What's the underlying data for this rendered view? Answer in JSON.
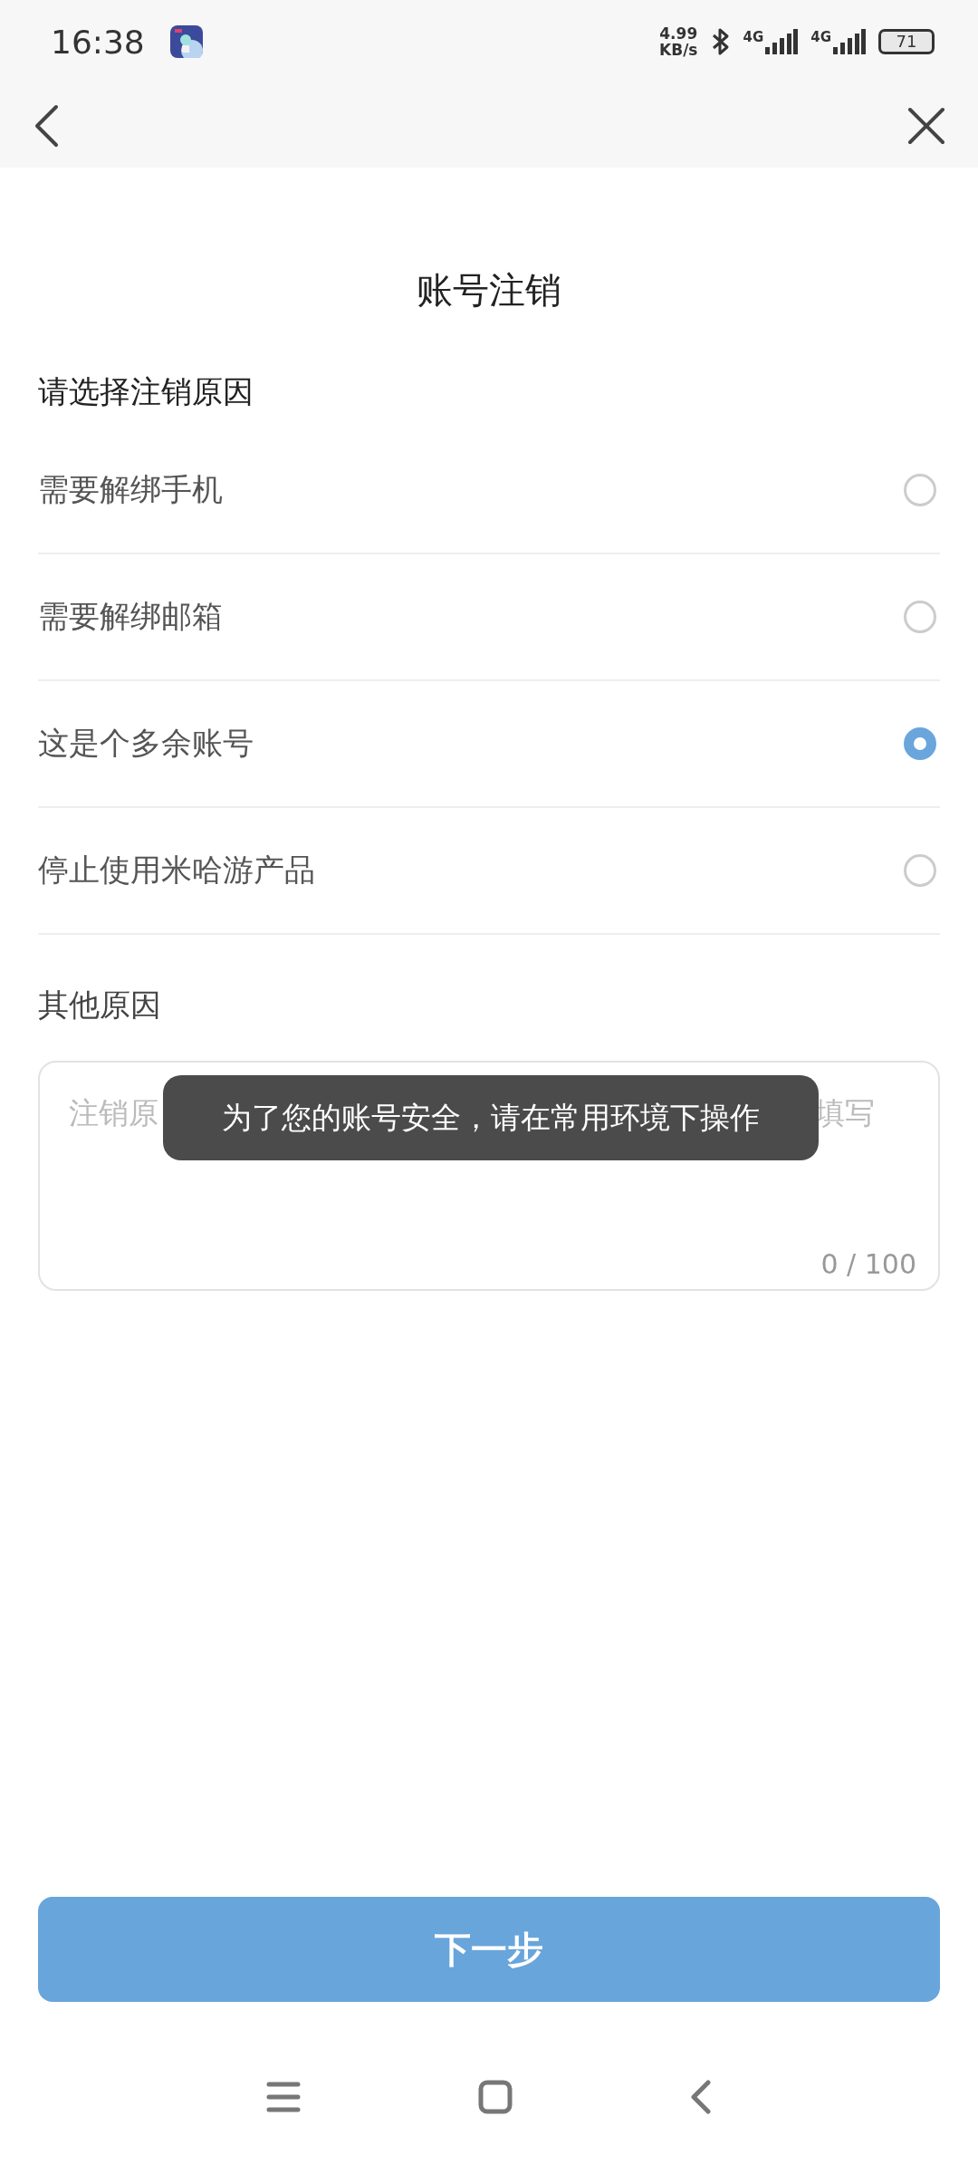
{
  "status_bar": {
    "time": "16:38",
    "speed_value": "4.99",
    "speed_unit": "KB/s",
    "networks": [
      {
        "label": "4G"
      },
      {
        "label": "4G"
      }
    ],
    "battery": "71"
  },
  "page": {
    "title": "账号注销",
    "prompt": "请选择注销原因"
  },
  "reasons": [
    {
      "label": "需要解绑手机",
      "selected": false
    },
    {
      "label": "需要解绑邮箱",
      "selected": false
    },
    {
      "label": "这是个多余账号",
      "selected": true
    },
    {
      "label": "停止使用米哈游产品",
      "selected": false
    }
  ],
  "other": {
    "label": "其他原因",
    "hint_start": "注销原",
    "hint_end": "填写",
    "counter": "0 / 100"
  },
  "toast": "为了您的账号安全，请在常用环境下操作",
  "next_button": "下一步"
}
